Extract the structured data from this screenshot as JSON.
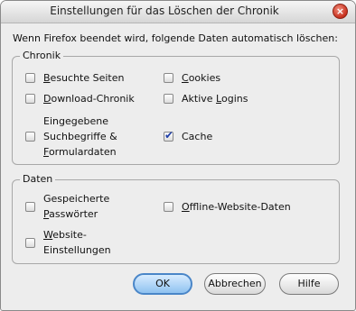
{
  "window": {
    "title": "Einstellungen für das Löschen der Chronik",
    "close_glyph": "×"
  },
  "intro": "Wenn Firefox beendet wird, folgende Daten automatisch löschen:",
  "chronik": {
    "legend": "Chronik",
    "items": [
      {
        "label": "Besuchte Seiten",
        "access": "B",
        "checked": false
      },
      {
        "label": "Cookies",
        "access": "C",
        "checked": false
      },
      {
        "label": "Download-Chronik",
        "access": "D",
        "checked": false
      },
      {
        "label": "Aktive Logins",
        "access": "L",
        "checked": false
      },
      {
        "label_lines": [
          "Eingegebene",
          "Suchbegriffe &",
          "Formulardaten"
        ],
        "access": "F",
        "checked": false
      },
      {
        "label": "Cache",
        "checked": true
      }
    ]
  },
  "daten": {
    "legend": "Daten",
    "items": [
      {
        "label_lines": [
          "Gespeicherte",
          "Passwörter"
        ],
        "access": "P",
        "checked": false
      },
      {
        "label": "Offline-Website-Daten",
        "access": "O",
        "checked": false
      },
      {
        "label_lines": [
          "Website-",
          "Einstellungen"
        ],
        "access": "W",
        "checked": false
      }
    ]
  },
  "buttons": {
    "ok": "OK",
    "cancel": "Abbrechen",
    "help": "Hilfe"
  },
  "colors": {
    "default_button": "#8fc2f0",
    "checkmark": "#1f3fa8",
    "close_button": "#c8301e"
  }
}
